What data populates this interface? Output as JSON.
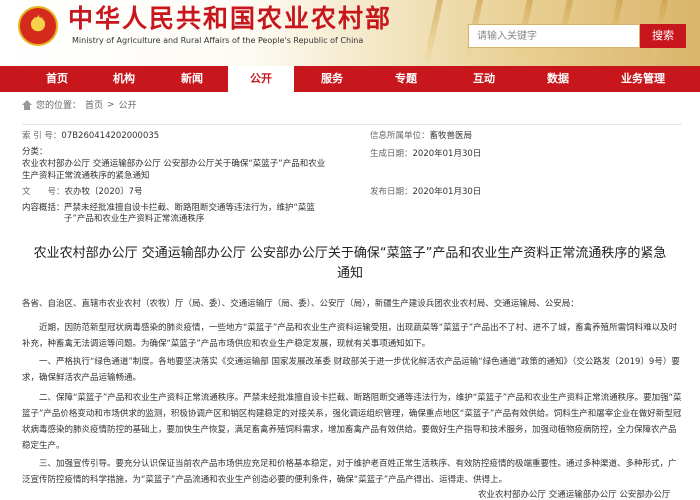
{
  "header": {
    "title": "中华人民共和国农业农村部",
    "subtitle": "Ministry of Agriculture and Rural Affairs of the People's Republic of China",
    "search_placeholder": "请输入关键字",
    "search_button": "搜索",
    "brand_color": "#c8161d"
  },
  "nav": {
    "items": [
      "首页",
      "机构",
      "新闻",
      "公开",
      "服务",
      "专题",
      "互动",
      "数据",
      "业务管理"
    ],
    "active": "公开"
  },
  "breadcrumb": {
    "location_label": "您的位置：",
    "home": "首页",
    "separator": ">",
    "current": "公开"
  },
  "meta": {
    "index_label": "索 引 号：",
    "index_value": "07B260414202000035",
    "category_label": "分类：",
    "title_line1": "农业农村部办公厅 交通运输部办公厅 公安部办公厅关于确保“菜篮子”产品和农业",
    "title_line2": "生产资料正常流通秩序的紧急通知",
    "doc_no_label": "文　　号：",
    "doc_no_value": "农办牧〔2020〕7号",
    "summary_label": "内容概括：",
    "summary_line1": "严禁未经批准擅自设卡拦截、断路阻断交通等违法行为，维护“菜篮",
    "summary_line2": "子”产品和农业生产资料正常流通秩序",
    "source_label": "信息所属单位：",
    "source_value": "畜牧兽医局",
    "created_label": "生成日期：",
    "created_value": "2020年01月30日",
    "published_label": "发布日期：",
    "published_value": "2020年01月30日"
  },
  "article": {
    "title_line1": "农业农村部办公厅 交通运输部办公厅 公安部办公厅关于确保“菜篮子”产品和农业生产资料正常流通秩序的紧急",
    "title_line2": "通知",
    "salutation": "各省、自治区、直辖市农业农村（农牧）厅（局、委）、交通运输厅（局、委）、公安厅（局），新疆生产建设兵团农业农村局、交通运输局、公安局：",
    "p1": "近期，因防范新型冠状病毒感染的肺炎疫情，一些地方“菜篮子”产品和农业生产资料运输受阻，出现蔬菜等“菜篮子”产品出不了村、进不了城，畜禽养殖所需饲料难以及时补充，种畜禽无法调运等问题。为确保“菜篮子”产品市场供应和农业生产稳定发展，现就有关事项通知如下。",
    "p2": "一、严格执行“绿色通道”制度。各地要坚决落实《交通运输部 国家发展改革委 财政部关于进一步优化鲜活农产品运输“绿色通道”政策的通知》（交公路发〔2019〕9号）要求，确保鲜活农产品运输畅通。",
    "p3": "二、保障“菜篮子”产品和农业生产资料正常流通秩序。严禁未经批准擅自设卡拦截、断路阻断交通等违法行为，维护“菜篮子”产品和农业生产资料正常流通秩序。要加强“菜篮子”产品价格变动和市场供求的监测，积极协调产区和销区构建稳定的对接关系，强化调运组织管理，确保重点地区“菜篮子”产品有效供给。饲料生产和屠宰企业在做好新型冠状病毒感染的肺炎疫情防控的基础上，要加快生产恢复，满足畜禽养殖饲料需求，增加畜禽产品有效供给。要做好生产指导和技术服务，加强动植物疫病防控，全力保障农产品稳定生产。",
    "p4": "三、加强宣传引导。要充分认识保证当前农产品市场供应充足和价格基本稳定，对于维护老百姓正常生活秩序、有效防控疫情的极端重要性。通过多种渠道、多种形式，广泛宣传防控疫情的科学措施，为“菜篮子”产品流通和农业生产创造必要的便利条件，确保“菜篮子”产品产得出、运得走、供得上。",
    "signature": "农业农村部办公厅 交通运输部办公厅 公安部办公厅"
  }
}
